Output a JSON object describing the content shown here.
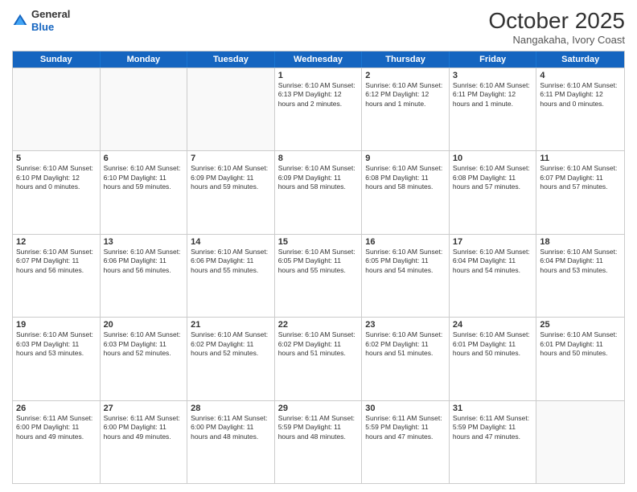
{
  "header": {
    "logo_line1": "General",
    "logo_line2": "Blue",
    "month": "October 2025",
    "location": "Nangakaha, Ivory Coast"
  },
  "days_of_week": [
    "Sunday",
    "Monday",
    "Tuesday",
    "Wednesday",
    "Thursday",
    "Friday",
    "Saturday"
  ],
  "weeks": [
    [
      {
        "day": "",
        "info": ""
      },
      {
        "day": "",
        "info": ""
      },
      {
        "day": "",
        "info": ""
      },
      {
        "day": "1",
        "info": "Sunrise: 6:10 AM\nSunset: 6:13 PM\nDaylight: 12 hours\nand 2 minutes."
      },
      {
        "day": "2",
        "info": "Sunrise: 6:10 AM\nSunset: 6:12 PM\nDaylight: 12 hours\nand 1 minute."
      },
      {
        "day": "3",
        "info": "Sunrise: 6:10 AM\nSunset: 6:11 PM\nDaylight: 12 hours\nand 1 minute."
      },
      {
        "day": "4",
        "info": "Sunrise: 6:10 AM\nSunset: 6:11 PM\nDaylight: 12 hours\nand 0 minutes."
      }
    ],
    [
      {
        "day": "5",
        "info": "Sunrise: 6:10 AM\nSunset: 6:10 PM\nDaylight: 12 hours\nand 0 minutes."
      },
      {
        "day": "6",
        "info": "Sunrise: 6:10 AM\nSunset: 6:10 PM\nDaylight: 11 hours\nand 59 minutes."
      },
      {
        "day": "7",
        "info": "Sunrise: 6:10 AM\nSunset: 6:09 PM\nDaylight: 11 hours\nand 59 minutes."
      },
      {
        "day": "8",
        "info": "Sunrise: 6:10 AM\nSunset: 6:09 PM\nDaylight: 11 hours\nand 58 minutes."
      },
      {
        "day": "9",
        "info": "Sunrise: 6:10 AM\nSunset: 6:08 PM\nDaylight: 11 hours\nand 58 minutes."
      },
      {
        "day": "10",
        "info": "Sunrise: 6:10 AM\nSunset: 6:08 PM\nDaylight: 11 hours\nand 57 minutes."
      },
      {
        "day": "11",
        "info": "Sunrise: 6:10 AM\nSunset: 6:07 PM\nDaylight: 11 hours\nand 57 minutes."
      }
    ],
    [
      {
        "day": "12",
        "info": "Sunrise: 6:10 AM\nSunset: 6:07 PM\nDaylight: 11 hours\nand 56 minutes."
      },
      {
        "day": "13",
        "info": "Sunrise: 6:10 AM\nSunset: 6:06 PM\nDaylight: 11 hours\nand 56 minutes."
      },
      {
        "day": "14",
        "info": "Sunrise: 6:10 AM\nSunset: 6:06 PM\nDaylight: 11 hours\nand 55 minutes."
      },
      {
        "day": "15",
        "info": "Sunrise: 6:10 AM\nSunset: 6:05 PM\nDaylight: 11 hours\nand 55 minutes."
      },
      {
        "day": "16",
        "info": "Sunrise: 6:10 AM\nSunset: 6:05 PM\nDaylight: 11 hours\nand 54 minutes."
      },
      {
        "day": "17",
        "info": "Sunrise: 6:10 AM\nSunset: 6:04 PM\nDaylight: 11 hours\nand 54 minutes."
      },
      {
        "day": "18",
        "info": "Sunrise: 6:10 AM\nSunset: 6:04 PM\nDaylight: 11 hours\nand 53 minutes."
      }
    ],
    [
      {
        "day": "19",
        "info": "Sunrise: 6:10 AM\nSunset: 6:03 PM\nDaylight: 11 hours\nand 53 minutes."
      },
      {
        "day": "20",
        "info": "Sunrise: 6:10 AM\nSunset: 6:03 PM\nDaylight: 11 hours\nand 52 minutes."
      },
      {
        "day": "21",
        "info": "Sunrise: 6:10 AM\nSunset: 6:02 PM\nDaylight: 11 hours\nand 52 minutes."
      },
      {
        "day": "22",
        "info": "Sunrise: 6:10 AM\nSunset: 6:02 PM\nDaylight: 11 hours\nand 51 minutes."
      },
      {
        "day": "23",
        "info": "Sunrise: 6:10 AM\nSunset: 6:02 PM\nDaylight: 11 hours\nand 51 minutes."
      },
      {
        "day": "24",
        "info": "Sunrise: 6:10 AM\nSunset: 6:01 PM\nDaylight: 11 hours\nand 50 minutes."
      },
      {
        "day": "25",
        "info": "Sunrise: 6:10 AM\nSunset: 6:01 PM\nDaylight: 11 hours\nand 50 minutes."
      }
    ],
    [
      {
        "day": "26",
        "info": "Sunrise: 6:11 AM\nSunset: 6:00 PM\nDaylight: 11 hours\nand 49 minutes."
      },
      {
        "day": "27",
        "info": "Sunrise: 6:11 AM\nSunset: 6:00 PM\nDaylight: 11 hours\nand 49 minutes."
      },
      {
        "day": "28",
        "info": "Sunrise: 6:11 AM\nSunset: 6:00 PM\nDaylight: 11 hours\nand 48 minutes."
      },
      {
        "day": "29",
        "info": "Sunrise: 6:11 AM\nSunset: 5:59 PM\nDaylight: 11 hours\nand 48 minutes."
      },
      {
        "day": "30",
        "info": "Sunrise: 6:11 AM\nSunset: 5:59 PM\nDaylight: 11 hours\nand 47 minutes."
      },
      {
        "day": "31",
        "info": "Sunrise: 6:11 AM\nSunset: 5:59 PM\nDaylight: 11 hours\nand 47 minutes."
      },
      {
        "day": "",
        "info": ""
      }
    ]
  ]
}
